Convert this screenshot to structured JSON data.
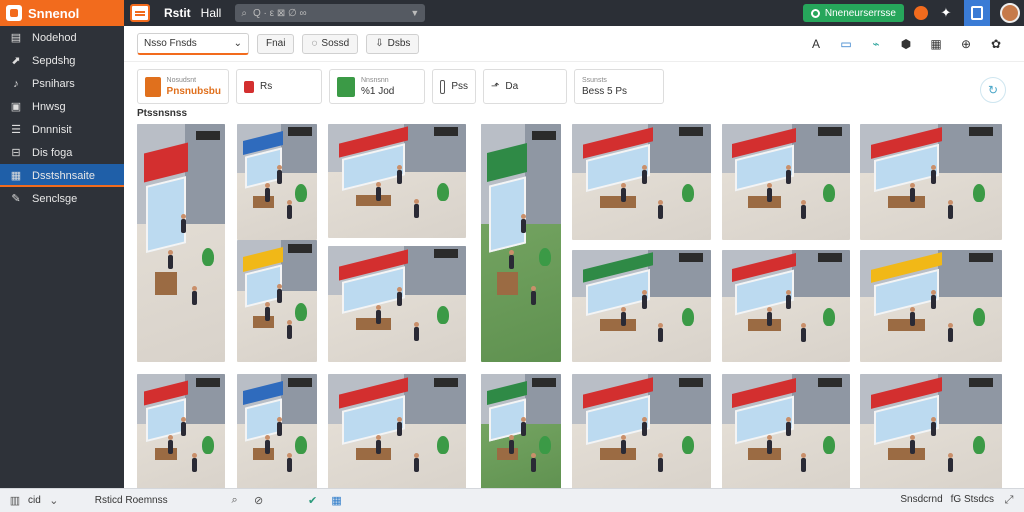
{
  "app": {
    "brand": "Snnenol",
    "title_primary": "Rstit",
    "title_secondary": "Hall",
    "search_placeholder": "Q  ·  ε  ⊠  ∅  ∞"
  },
  "topbar": {
    "status_label": "Nneneurserrsse",
    "icons": [
      "menu-icon",
      "search-icon",
      "status-icon",
      "tool-icon",
      "doc-icon",
      "avatar"
    ]
  },
  "sidebar": {
    "items": [
      {
        "label": "Nodehod",
        "icon": "doc-icon"
      },
      {
        "label": "Sepdshg",
        "icon": "chart-icon"
      },
      {
        "label": "Psnihars",
        "icon": "music-icon"
      },
      {
        "label": "Hnwsg",
        "icon": "lock-icon"
      },
      {
        "label": "Dnnnisit",
        "icon": "list-icon"
      },
      {
        "label": "Dis foga",
        "icon": "tag-icon"
      },
      {
        "label": "Dsstshnsaite",
        "icon": "grid-icon",
        "active": true
      },
      {
        "label": "Senclsge",
        "icon": "wrench-icon"
      }
    ]
  },
  "filters": {
    "select_value": "Nsso Fnsds",
    "chips": [
      {
        "label": "Fnai"
      },
      {
        "label": "Sossd",
        "icon": "spark-icon"
      },
      {
        "label": "Dsbs",
        "icon": "download-icon"
      }
    ]
  },
  "cards": [
    {
      "line1": "Nosudsnt",
      "line2": "Pnsnubsbu",
      "accent": "#e0701d"
    },
    {
      "line1": "",
      "line2": "Rs",
      "accent": "#d32f2f"
    },
    {
      "line1": "Nnsnsnn",
      "line2": "%1 Jod",
      "accent": "#3b9a46"
    },
    {
      "line1": "",
      "line2": "Pss",
      "accent": "#555555"
    },
    {
      "line1": "",
      "line2": "Da",
      "accent": "#333333"
    },
    {
      "line1": "Ssunsts",
      "line2": "Bess  5 Ps",
      "accent": "#e0701d"
    }
  ],
  "section_title": "Ptssnsnss",
  "tiles": [
    {
      "awning": "",
      "floor": "floor"
    },
    {
      "awning": "b",
      "floor": "floor"
    },
    {
      "awning": "",
      "floor": "floor"
    },
    {
      "awning": "g",
      "floor": "grass"
    },
    {
      "awning": "",
      "floor": "floor"
    },
    {
      "awning": "",
      "floor": "floor"
    },
    {
      "awning": "",
      "floor": "floor"
    },
    {
      "awning": "y",
      "floor": "floor"
    },
    {
      "awning": "",
      "floor": "floor"
    },
    {
      "awning": "g",
      "floor": "floor"
    },
    {
      "awning": "",
      "floor": "floor"
    },
    {
      "awning": "y",
      "floor": "floor"
    },
    {
      "awning": "",
      "floor": "floor"
    },
    {
      "awning": "b",
      "floor": "floor"
    },
    {
      "awning": "",
      "floor": "floor"
    },
    {
      "awning": "g",
      "floor": "grass"
    },
    {
      "awning": "",
      "floor": "floor"
    },
    {
      "awning": "",
      "floor": "floor"
    },
    {
      "awning": "",
      "floor": "floor"
    }
  ],
  "statusbar": {
    "left_label": "cid",
    "center_label": "Rsticd Roemnss",
    "right_label1": "Snsdcrnd",
    "right_label2": "fG  Stsdcs"
  }
}
